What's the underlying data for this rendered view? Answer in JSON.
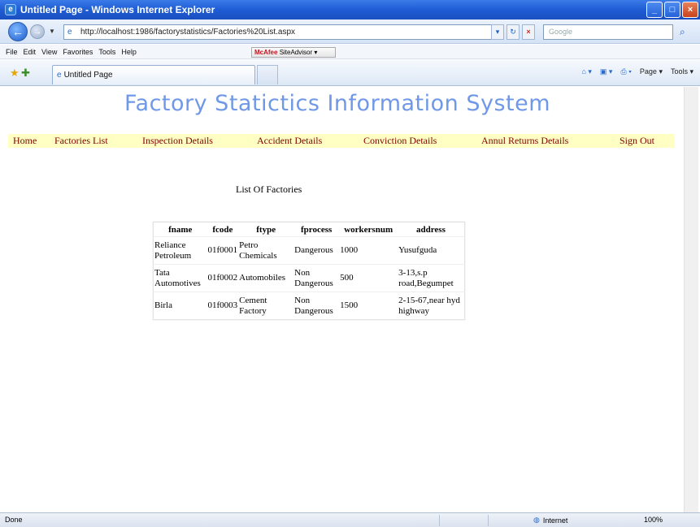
{
  "window": {
    "title": "Untitled Page - Windows Internet Explorer",
    "controls": {
      "minimize": "_",
      "maximize": "□",
      "close": "×"
    }
  },
  "toolbar": {
    "url": "http://localhost:1986/factorystatistics/Factories%20List.aspx",
    "search_placeholder": "Google"
  },
  "menu": [
    "File",
    "Edit",
    "View",
    "Favorites",
    "Tools",
    "Help"
  ],
  "mcafee": {
    "brand": "McAfee",
    "label": "SiteAdvisor ▾"
  },
  "tab": {
    "label": "Untitled Page"
  },
  "commands": {
    "page": "Page ▾",
    "tools": "Tools ▾"
  },
  "page": {
    "heading": "Factory Statictics Information System",
    "nav": [
      "Home",
      "Factories List",
      "Inspection Details",
      "Accident Details",
      "Conviction Details",
      "Annul Returns Details",
      "Sign Out"
    ],
    "list_title": "List Of Factories",
    "table": {
      "headers": [
        "fname",
        "fcode",
        "ftype",
        "fprocess",
        "workersnum",
        "address"
      ],
      "rows": [
        [
          "Reliance Petroleum",
          "01f0001",
          "Petro Chemicals",
          "Dangerous",
          "1000",
          "Yusufguda"
        ],
        [
          "Tata Automotives",
          "01f0002",
          "Automobiles",
          "Non Dangerous",
          "500",
          "3-13,s.p road,Begumpet"
        ],
        [
          "Birla",
          "01f0003",
          "Cement Factory",
          "Non Dangerous",
          "1500",
          "2-15-67,near hyd highway"
        ]
      ]
    }
  },
  "status": {
    "text": "Done",
    "zone": "Internet",
    "zoom": "100%"
  },
  "accent_colors": {
    "heading": "#6f98e8",
    "nav_bg": "#ffffc4",
    "nav_text": "#800000"
  }
}
